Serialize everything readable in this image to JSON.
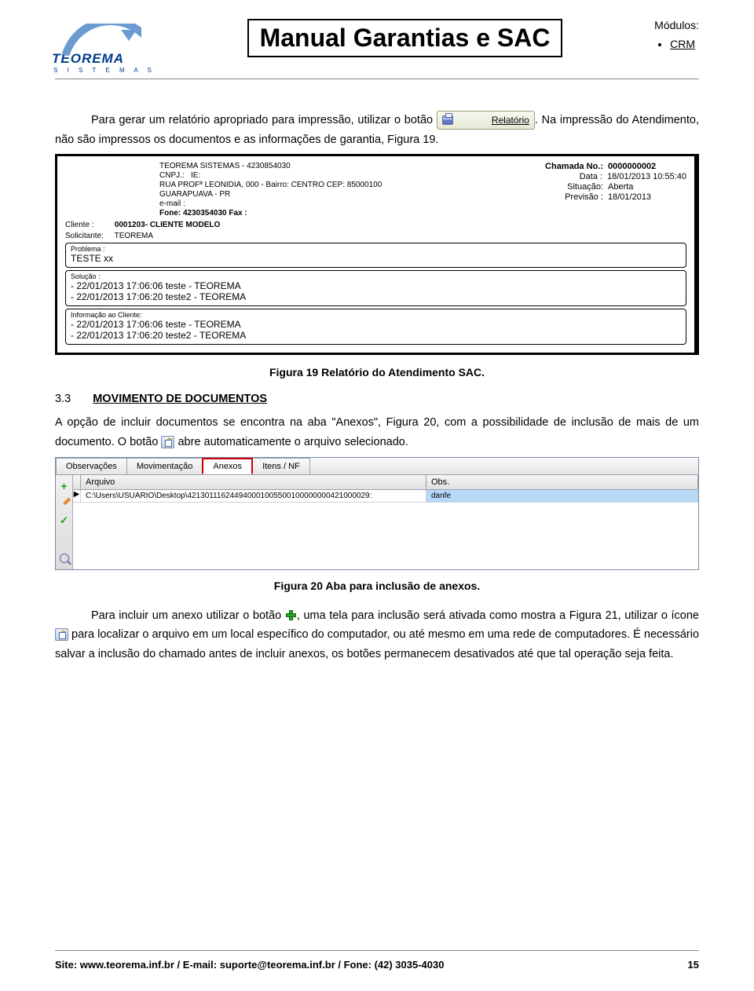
{
  "header": {
    "logo_text": "TEOREMA",
    "logo_sub": "S I S T E M A S",
    "title": "Manual Garantias e SAC",
    "modules_label": "Módulos:",
    "modules": [
      "CRM"
    ]
  },
  "paragraph_1a": "Para gerar um relatório apropriado para impressão, utilizar o botão ",
  "relatorio_btn": "Relatório",
  "paragraph_1b": ". Na impressão do Atendimento, não são impressos os documentos e as informações de garantia, Figura 19.",
  "report": {
    "company": "TEOREMA SISTEMAS - 4230854030",
    "cnpj_label": "CNPJ.:",
    "cnpj_value": "IE:",
    "address": "RUA PROFª LEONIDIA, 000 - Bairro: CENTRO CEP: 85000100",
    "city": "GUARAPUAVA - PR",
    "email_label": "e-mail :",
    "phone": "Fone: 4230354030 Fax :",
    "chamada_label": "Chamada No.:",
    "chamada_value": "0000000002",
    "data_label": "Data :",
    "data_value": "18/01/2013  10:55:40",
    "situacao_label": "Situação:",
    "situacao_value": "Aberta",
    "previsao_label": "Previsão :",
    "previsao_value": "18/01/2013",
    "cliente_label": "Cliente :",
    "cliente_value": "0001203- CLIENTE MODELO",
    "solicitante_label": "Solicitante:",
    "solicitante_value": "TEOREMA",
    "problema_label": "Problema :",
    "problema_value": "TESTE xx",
    "solucao_label": "Solução :",
    "solucao_lines": [
      "- 22/01/2013 17:06:06 teste - TEOREMA",
      "- 22/01/2013 17:06:20 teste2 - TEOREMA"
    ],
    "info_label": "Informação ao Cliente:",
    "info_lines": [
      "- 22/01/2013 17:06:06 teste - TEOREMA",
      "- 22/01/2013 17:06:20 teste2 - TEOREMA"
    ]
  },
  "caption_19": "Figura 19 Relatório do Atendimento SAC.",
  "section": {
    "num": "3.3",
    "title": "MOVIMENTO DE DOCUMENTOS"
  },
  "paragraph_2a": "A opção de incluir documentos se encontra na aba \"Anexos\", Figura 20, com a possibilidade de inclusão de mais de um documento. O botão ",
  "paragraph_2b": " abre automaticamente o arquivo selecionado.",
  "anexos": {
    "tabs": [
      "Observações",
      "Movimentação",
      "Anexos",
      "Itens / NF"
    ],
    "active_tab": 2,
    "col_file": "Arquivo",
    "col_obs": "Obs.",
    "row_file": "C:\\Users\\USUARIO\\Desktop\\421301116244940001005500100000000421000029:",
    "row_obs": "danfe"
  },
  "caption_20": "Figura 20 Aba para inclusão de anexos.",
  "paragraph_3a": "Para incluir um anexo utilizar o botão ",
  "paragraph_3b": ", uma tela para inclusão será ativada como mostra a Figura 21, utilizar o ícone ",
  "paragraph_3c": " para localizar o arquivo em um local específico do computador, ou até mesmo em uma rede de computadores. É necessário salvar a inclusão do chamado antes de incluir anexos, os botões permanecem desativados até que tal operação seja feita.",
  "footer": {
    "left": "Site: www.teorema.inf.br / E-mail: suporte@teorema.inf.br / Fone: (42) 3035-4030",
    "right": "15"
  }
}
